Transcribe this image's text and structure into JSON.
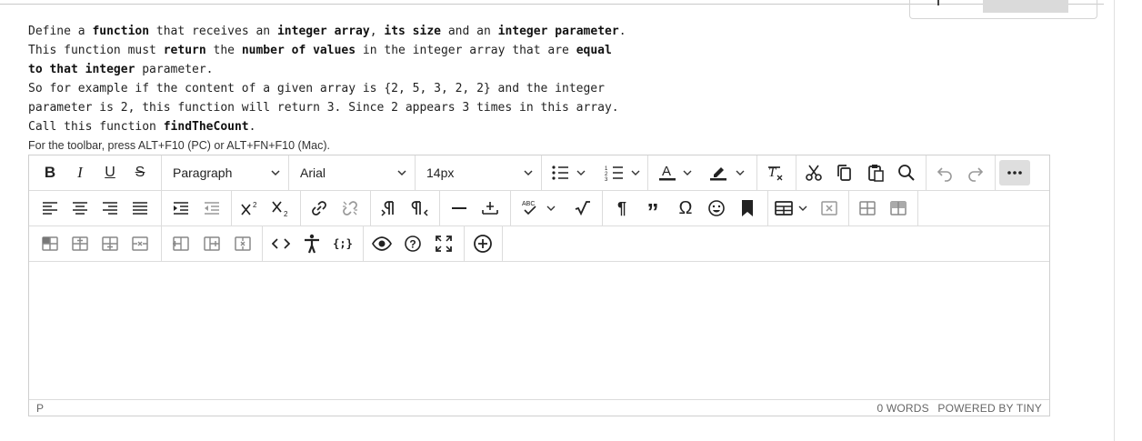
{
  "question": {
    "lines": [
      [
        {
          "t": "Define a ",
          "b": false
        },
        {
          "t": "function",
          "b": true
        },
        {
          "t": " that receives an ",
          "b": false
        },
        {
          "t": "integer array",
          "b": true
        },
        {
          "t": ", ",
          "b": false
        },
        {
          "t": "its size",
          "b": true
        },
        {
          "t": " and an ",
          "b": false
        },
        {
          "t": "integer parameter",
          "b": true
        },
        {
          "t": ".",
          "b": false
        }
      ],
      [
        {
          "t": "This function must ",
          "b": false
        },
        {
          "t": "return",
          "b": true
        },
        {
          "t": " the ",
          "b": false
        },
        {
          "t": "number of values",
          "b": true
        },
        {
          "t": " in the integer array that are ",
          "b": false
        },
        {
          "t": "equal",
          "b": true
        }
      ],
      [
        {
          "t": "to that integer",
          "b": true
        },
        {
          "t": " parameter.",
          "b": false
        }
      ],
      [
        {
          "t": "So for example if the content of a given array is {2, 5, 3, 2, 2} and the integer",
          "b": false
        }
      ],
      [
        {
          "t": "parameter is 2, this function will return 3. Since 2 appears 3 times in this array.",
          "b": false
        }
      ],
      [
        {
          "t": "Call this function ",
          "b": false
        },
        {
          "t": "findTheCount",
          "b": true
        },
        {
          "t": ".",
          "b": false
        }
      ]
    ]
  },
  "editor": {
    "toolbar_hint": "For the toolbar, press ALT+F10 (PC) or ALT+FN+F10 (Mac).",
    "block_format": "Paragraph",
    "font_family": "Arial",
    "font_size": "14px",
    "status_path": "P",
    "word_count": "0 WORDS",
    "powered_by": "POWERED BY TINY"
  }
}
